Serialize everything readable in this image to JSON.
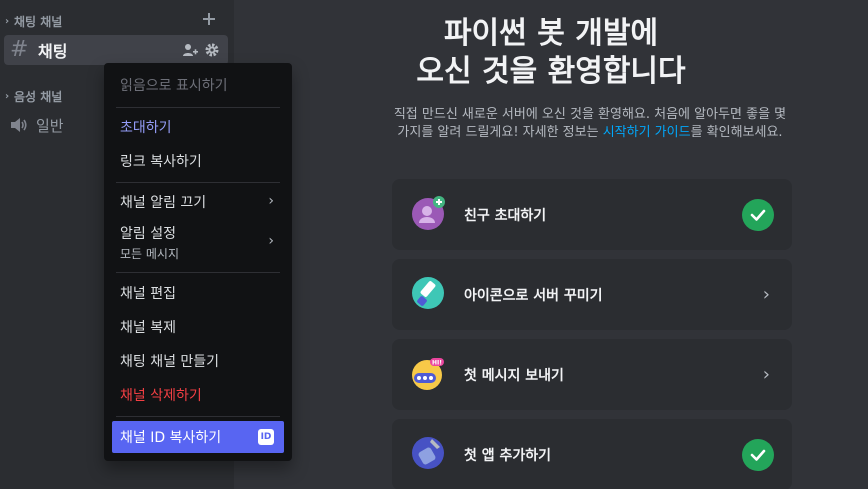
{
  "sidebar": {
    "text_category": "채팅 채널",
    "active_channel": "채팅",
    "voice_category": "음성 채널",
    "voice_channel": "일반"
  },
  "context_menu": {
    "mark_read": "읽음으로 표시하기",
    "invite": "초대하기",
    "copy_link": "링크 복사하기",
    "mute_channel": "채널 알림 끄기",
    "notif_settings": "알림 설정",
    "notif_settings_sub": "모든 메시지",
    "edit_channel": "채널 편집",
    "duplicate_channel": "채널 복제",
    "create_text_channel": "채팅 채널 만들기",
    "delete_channel": "채널 삭제하기",
    "copy_channel_id": "채널 ID 복사하기",
    "id_badge": "ID"
  },
  "welcome": {
    "title_line1": "파이썬 봇 개발에",
    "title_line2": "오신 것을 환영합니다",
    "desc_part1": "직접 만드신 새로운 서버에 오신 것을 환영해요. 처음에 알아두면 좋을 몇 가지를 알려 드릴게요! 자세한 정보는 ",
    "desc_link": "시작하기 가이드",
    "desc_part2": "를 확인해보세요."
  },
  "cards": [
    {
      "label": "친구 초대하기",
      "status": "done"
    },
    {
      "label": "아이콘으로 서버 꾸미기",
      "status": "todo"
    },
    {
      "label": "첫 메시지 보내기",
      "status": "todo"
    },
    {
      "label": "첫 앱 추가하기",
      "status": "done"
    }
  ],
  "colors": {
    "accent": "#5865f2",
    "success": "#23a55a",
    "danger": "#f23f43",
    "link": "#00a8fc"
  }
}
